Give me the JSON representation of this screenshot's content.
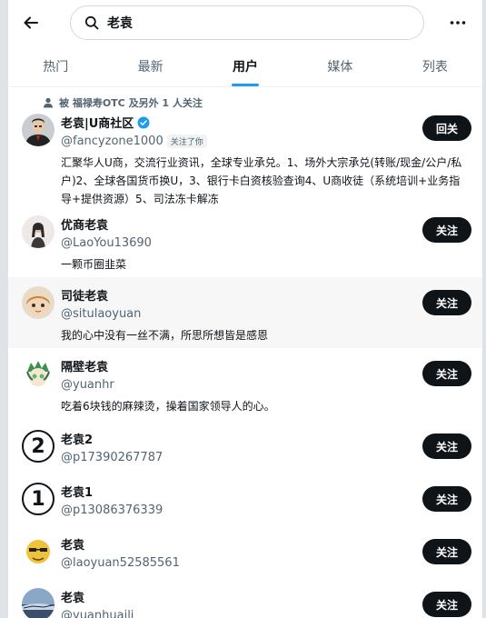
{
  "search": {
    "query": "老袁"
  },
  "tabs": [
    "热门",
    "最新",
    "用户",
    "媒体",
    "列表"
  ],
  "active_tab": "用户",
  "social_context": "被 福禄寿OTC 及另外 1 人关注",
  "users": [
    {
      "name": "老袁|U商社区",
      "handle": "@fancyzone1000",
      "verified": true,
      "follows_you": "关注了你",
      "bio": "汇聚华人U商，交流行业资讯，全球专业承兑。1、场外大宗承兑(转账/现金/公户/私户)2、全球各国货币换U，3、银行卡白资核验查询4、U商收徒（系统培训+业务指导+提供资源）5、司法冻卡解冻",
      "button": "回关"
    },
    {
      "name": "优商老袁",
      "handle": "@LaoYou13690",
      "bio": "一颗币圈韭菜",
      "button": "关注"
    },
    {
      "name": "司徒老袁",
      "handle": "@situlaoyuan",
      "bio": "我的心中没有一丝不满，所思所想皆是感恩",
      "button": "关注"
    },
    {
      "name": "隔壁老袁",
      "handle": "@yuanhr",
      "bio": "吃着6块钱的麻辣烫，操着国家领导人的心。",
      "button": "关注"
    },
    {
      "name": "老袁2",
      "handle": "@p17390267787",
      "bio": "",
      "button": "关注",
      "avatar_glyph": "②"
    },
    {
      "name": "老袁1",
      "handle": "@p13086376339",
      "bio": "",
      "button": "关注",
      "avatar_glyph": "①"
    },
    {
      "name": "老袁",
      "handle": "@laoyuan52585561",
      "bio": "",
      "button": "关注"
    },
    {
      "name": "老袁",
      "handle": "@yuanhuaili",
      "bio": "",
      "button": "关注"
    }
  ],
  "colors": {
    "accent": "#1d9bf0",
    "button_bg": "#0f1419",
    "muted_text": "#536471"
  }
}
